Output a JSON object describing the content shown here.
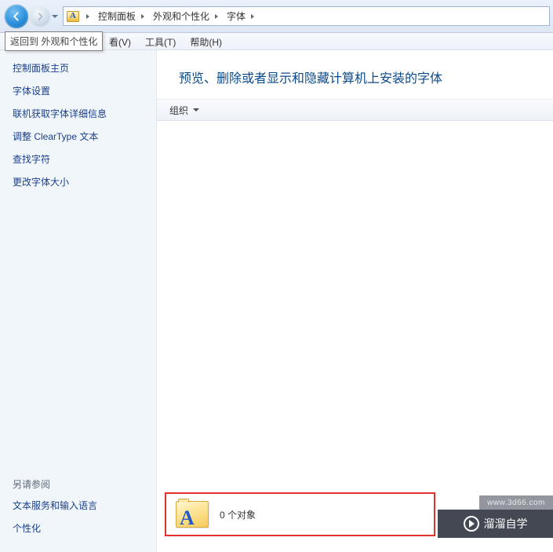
{
  "nav": {
    "tooltip": "返回到 外观和个性化"
  },
  "breadcrumb": {
    "items": [
      "控制面板",
      "外观和个性化",
      "字体"
    ]
  },
  "menu": {
    "view": "看(V)",
    "tools": "工具(T)",
    "help": "帮助(H)"
  },
  "sidebar": {
    "home": "控制面板主页",
    "links": [
      "字体设置",
      "联机获取字体详细信息",
      "调整 ClearType 文本",
      "查找字符",
      "更改字体大小"
    ],
    "see_also_label": "另请参阅",
    "see_also": [
      "文本服务和输入语言",
      "个性化"
    ]
  },
  "content": {
    "heading": "预览、删除或者显示和隐藏计算机上安装的字体",
    "toolbar": {
      "organize": "组织"
    },
    "status": "0 个对象"
  },
  "watermark": {
    "brand": "溜溜自学",
    "url": "www.3d66.com"
  }
}
